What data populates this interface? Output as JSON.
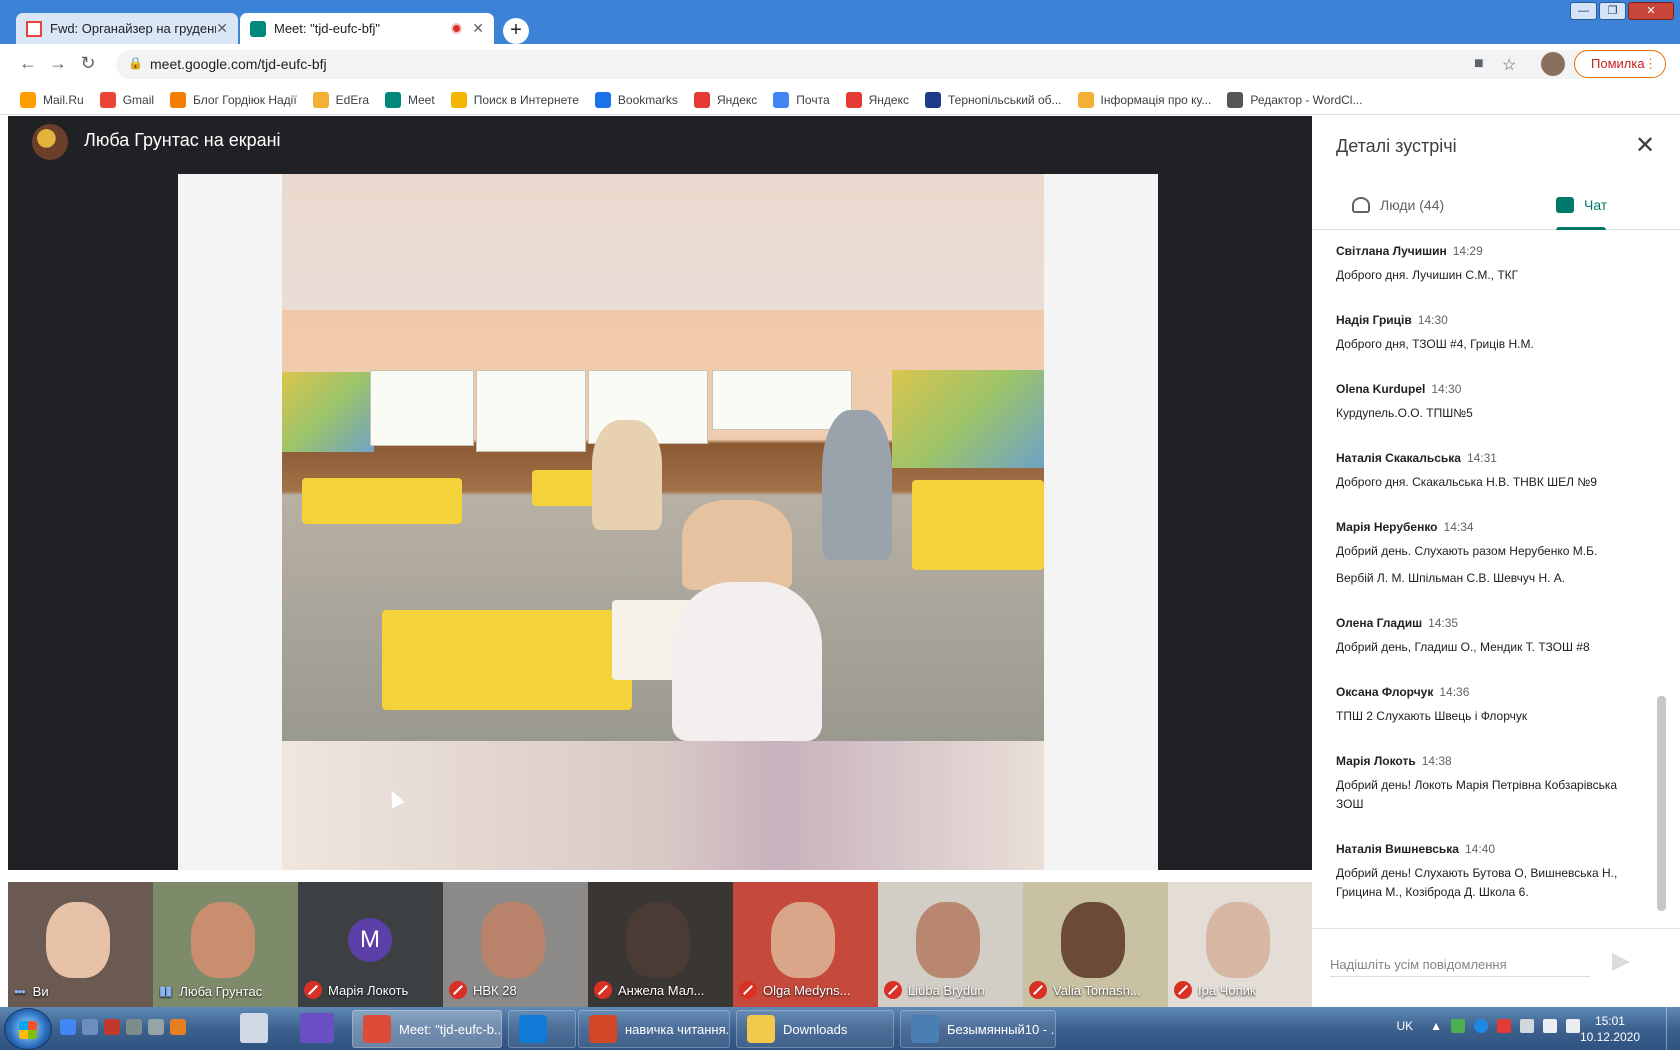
{
  "browser": {
    "tabs": [
      {
        "title": "Fwd: Органайзер на грудень - g",
        "active": false
      },
      {
        "title": "Meet: \"tjd-eufc-bfj\"",
        "active": true
      }
    ],
    "new_tab_label": "+",
    "window_buttons": [
      "—",
      "❐",
      "✕"
    ],
    "url": "meet.google.com/tjd-eufc-bfj",
    "error_button": "Помилка",
    "bookmarks": [
      {
        "label": "Mail.Ru",
        "color": "#ff9e00"
      },
      {
        "label": "Gmail",
        "color": "#ea4335"
      },
      {
        "label": "Блог Гордіюк Надії",
        "color": "#f57d00"
      },
      {
        "label": "EdEra",
        "color": "#f2b035"
      },
      {
        "label": "Meet",
        "color": "#00897b"
      },
      {
        "label": "Поиск в Интернете",
        "color": "#f4b400"
      },
      {
        "label": "Bookmarks",
        "color": "#1a73e8"
      },
      {
        "label": "Яндекс",
        "color": "#e53935"
      },
      {
        "label": "Почта",
        "color": "#4285f4"
      },
      {
        "label": "Яндекс",
        "color": "#e53935"
      },
      {
        "label": "Тернопільський об...",
        "color": "#1e3a8a"
      },
      {
        "label": "Інформація про ку...",
        "color": "#f2b035"
      },
      {
        "label": "Редактор - WordCl...",
        "color": "#555555"
      }
    ]
  },
  "meet": {
    "presenter_label": "Люба Грунтас на екрані",
    "participants": [
      {
        "name": "Ви",
        "muted": false,
        "speaking": true,
        "bg": "#6a5a52",
        "face": "#e8c2a8"
      },
      {
        "name": "Люба Грунтас",
        "muted": false,
        "speaking": true,
        "bg": "#7d8b6a",
        "face": "#c98d70"
      },
      {
        "name": "Марія Локоть",
        "muted": true,
        "speaking": false,
        "bg": "#3c4043",
        "face": "",
        "initial": "M"
      },
      {
        "name": "НВК 28",
        "muted": true,
        "speaking": false,
        "bg": "#8c8a88",
        "face": "#b8836a"
      },
      {
        "name": "Анжела Мал...",
        "muted": true,
        "speaking": false,
        "bg": "#3a3634",
        "face": "#4a3b34"
      },
      {
        "name": "Olga Medyns...",
        "muted": true,
        "speaking": false,
        "bg": "#c64a3c",
        "face": "#d9a68a"
      },
      {
        "name": "Liuba Brydun",
        "muted": true,
        "speaking": false,
        "bg": "#d2cec6",
        "face": "#b98770"
      },
      {
        "name": "Valia Tomash...",
        "muted": true,
        "speaking": false,
        "bg": "#c8c2a2",
        "face": "#6b4a3a"
      },
      {
        "name": "Іра Чопик",
        "muted": true,
        "speaking": false,
        "bg": "#e4ddd6",
        "face": "#d6b7a4"
      }
    ]
  },
  "panel": {
    "title": "Деталі зустрічі",
    "tab_people": "Люди (44)",
    "tab_chat": "Чат",
    "messages": [
      {
        "sender": "Світлана Лучишин",
        "time": "14:29",
        "lines": [
          "Доброго дня. Лучишин С.М., ТКГ"
        ]
      },
      {
        "sender": "Надія Гриців",
        "time": "14:30",
        "lines": [
          "Доброго дня, ТЗОШ #4, Гриців Н.М."
        ]
      },
      {
        "sender": "Olena Kurdupel",
        "time": "14:30",
        "lines": [
          "Курдупель.О.О. ТПШ№5"
        ]
      },
      {
        "sender": "Наталія Скакальська",
        "time": "14:31",
        "lines": [
          "Доброго дня. Скакальська Н.В. ТНВК ШЕЛ №9"
        ]
      },
      {
        "sender": "Марія Нерубенко",
        "time": "14:34",
        "lines": [
          "Добрий день. Слухають разом Нерубенко М.Б.",
          "Вербій Л. М. Шпільман С.В. Шевчуч Н. А."
        ]
      },
      {
        "sender": "Олена Гладиш",
        "time": "14:35",
        "lines": [
          "Добрий день, Гладиш О., Мендик Т. ТЗОШ #8"
        ]
      },
      {
        "sender": "Оксана Флорчук",
        "time": "14:36",
        "lines": [
          "ТПШ 2 Слухають Швець і Флорчук"
        ]
      },
      {
        "sender": "Марія Локоть",
        "time": "14:38",
        "lines": [
          "Добрий день! Локоть Марія Петрівна Кобзарівська ЗОШ"
        ]
      },
      {
        "sender": "Наталія Вишневська",
        "time": "14:40",
        "lines": [
          "Добрий день! Слухають Бутова О, Вишневська Н., Грицина М., Козіброда Д. Школа 6."
        ]
      }
    ],
    "compose_placeholder": "Надішліть усім повідомлення"
  },
  "taskbar": {
    "items": [
      {
        "label": "Meet: \"tjd-eufc-b...",
        "active": true,
        "color": "#dd4b39"
      },
      {
        "label": "",
        "active": false,
        "color": "#0f7bd6"
      },
      {
        "label": "навичка читання...",
        "active": false,
        "color": "#d24726"
      },
      {
        "label": "Downloads",
        "active": false,
        "color": "#f2c94c"
      },
      {
        "label": "Безымянный10 - ...",
        "active": false,
        "color": "#4a7fb5"
      }
    ],
    "language": "UK",
    "time": "15:01",
    "date": "10.12.2020"
  }
}
